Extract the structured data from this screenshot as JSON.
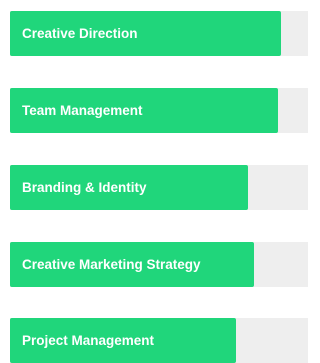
{
  "colors": {
    "bar_fill": "#20d67b",
    "track": "#eeeeee",
    "label": "#ffffff"
  },
  "skills": [
    {
      "label": "Creative Direction",
      "percent": 91
    },
    {
      "label": "Team Management",
      "percent": 90
    },
    {
      "label": "Branding & Identity",
      "percent": 80
    },
    {
      "label": "Creative Marketing Strategy",
      "percent": 82
    },
    {
      "label": "Project Management",
      "percent": 76
    }
  ]
}
